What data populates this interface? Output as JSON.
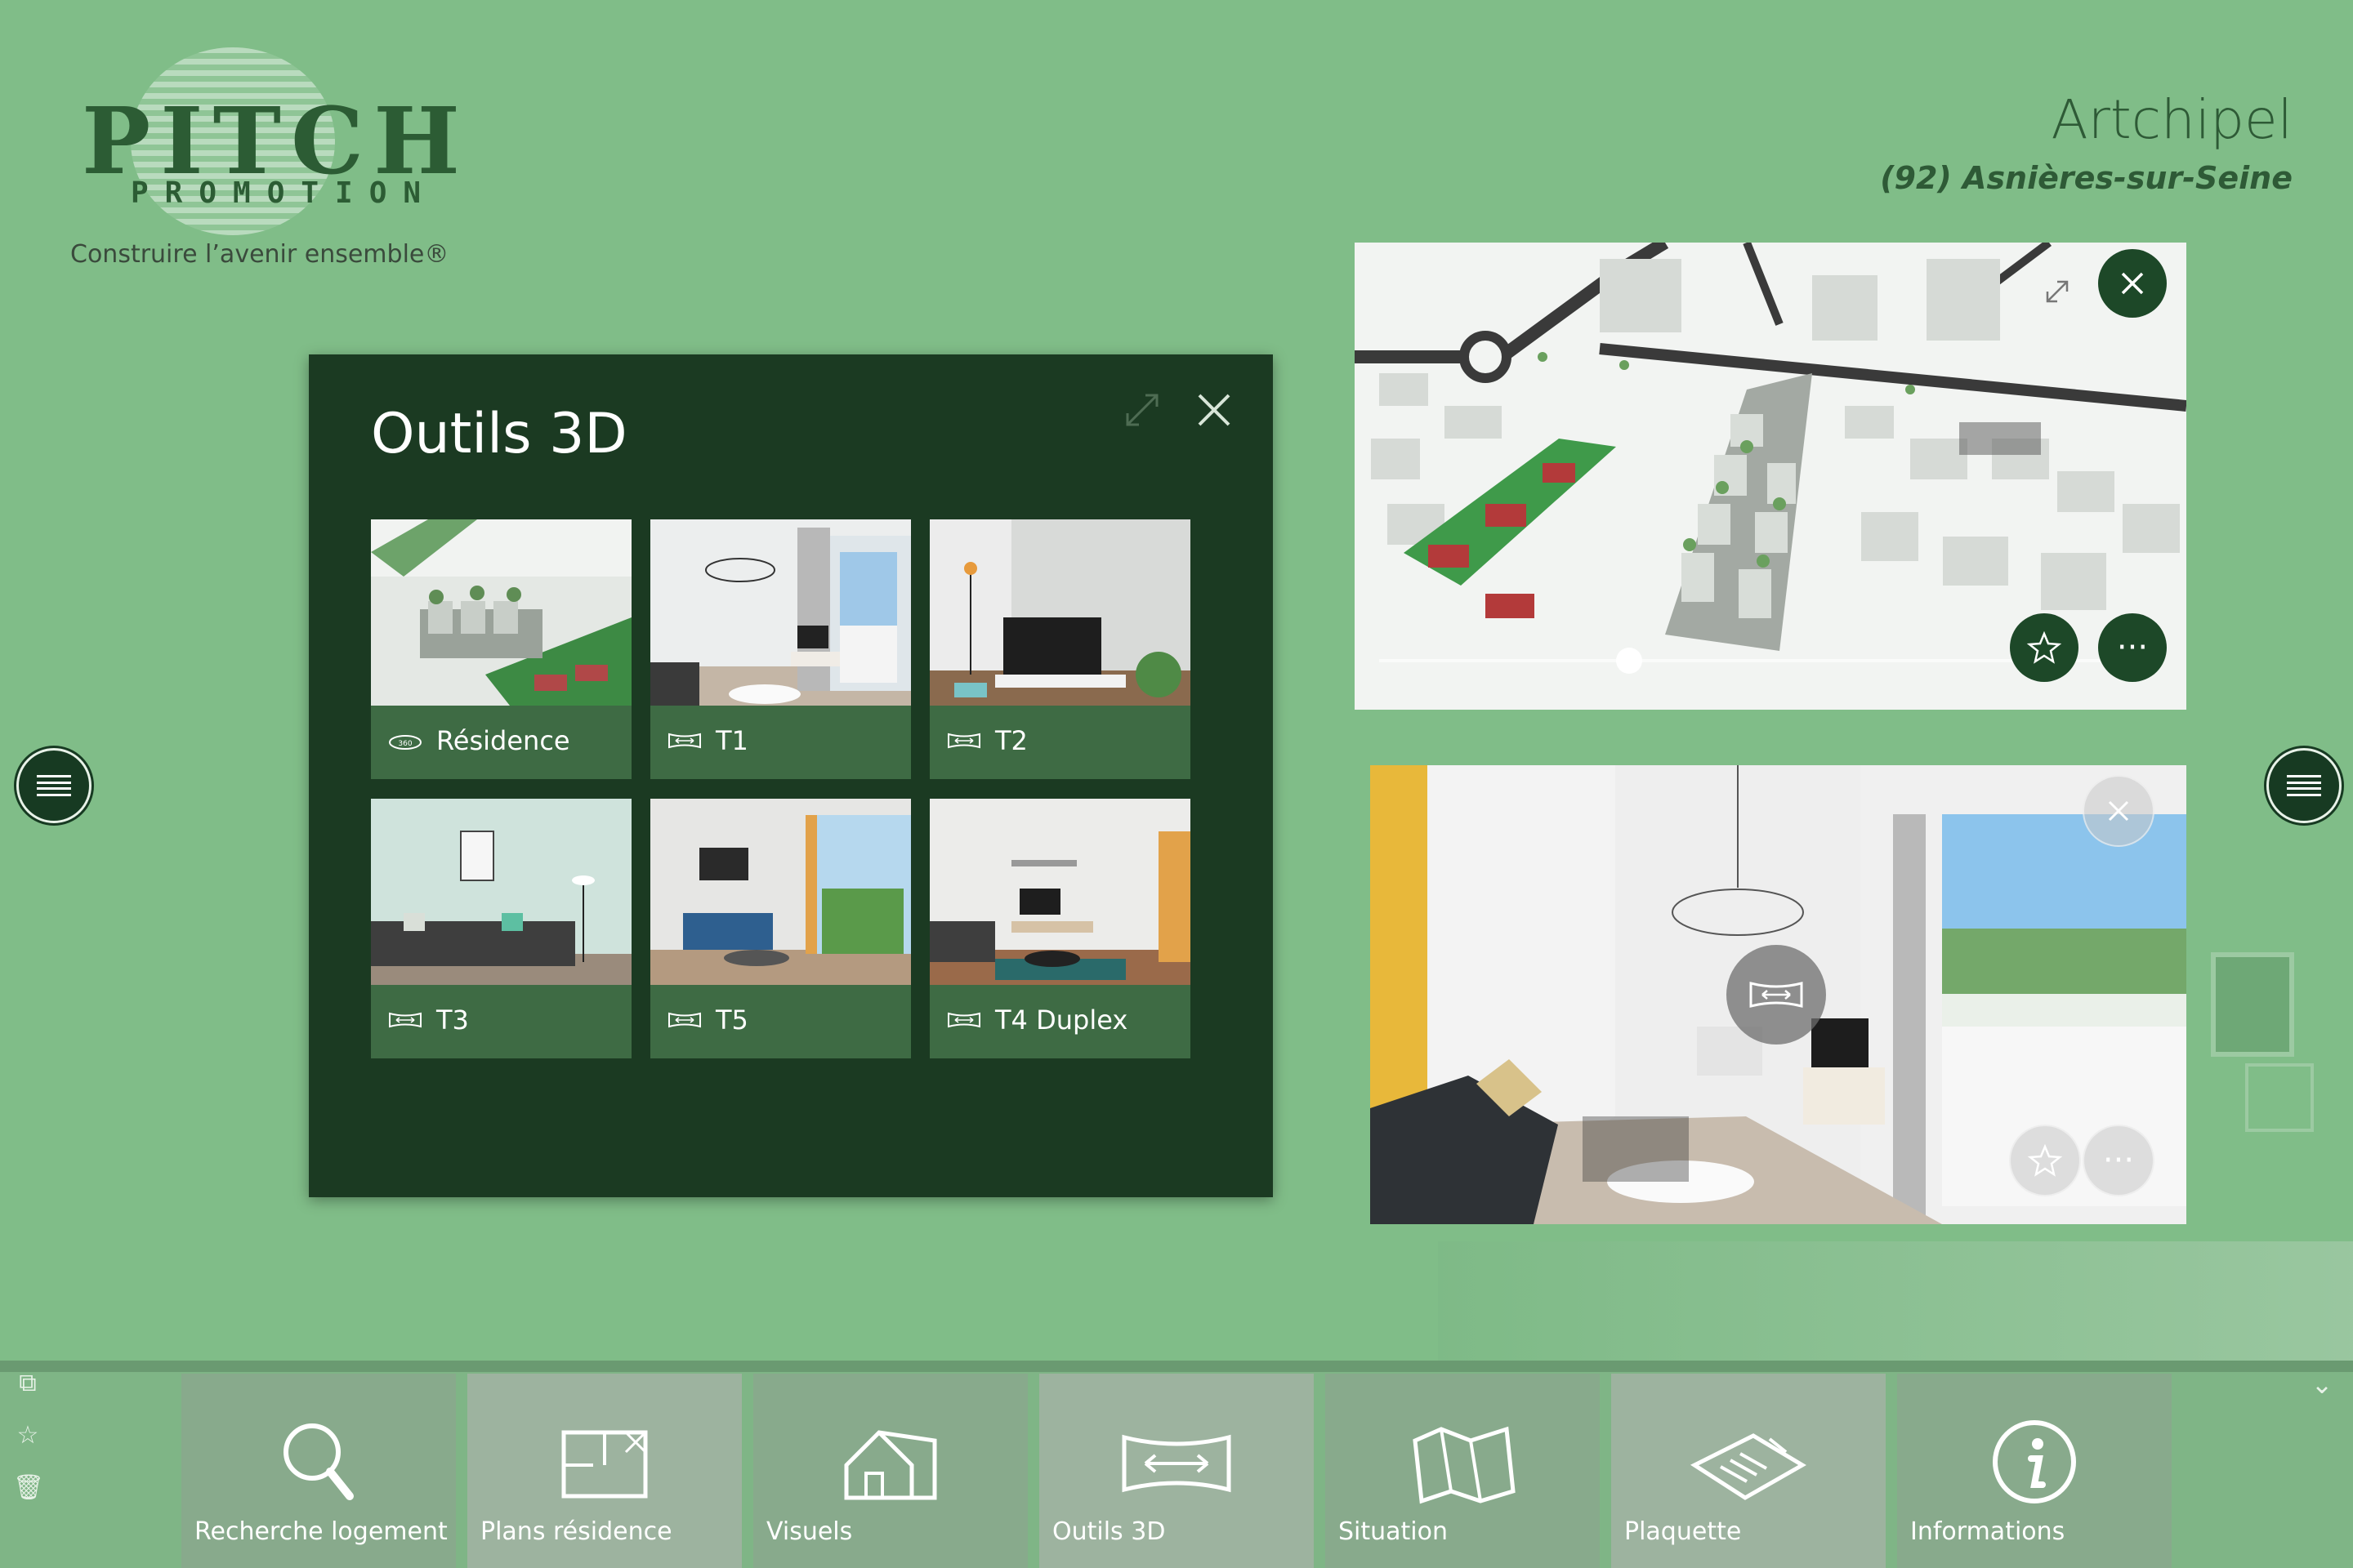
{
  "logo": {
    "word": "PITCH",
    "sub": "PROMOTION",
    "tagline": "Construire l’avenir ensemble®"
  },
  "project": {
    "title": "Artchipel",
    "location": "(92) Asnières-sur-Seine"
  },
  "panel": {
    "title": "Outils 3D",
    "tiles": [
      {
        "label": "Résidence",
        "icon": "360-icon"
      },
      {
        "label": "T1",
        "icon": "panorama-icon"
      },
      {
        "label": "T2",
        "icon": "panorama-icon"
      },
      {
        "label": "T3",
        "icon": "panorama-icon"
      },
      {
        "label": "T5",
        "icon": "panorama-icon"
      },
      {
        "label": "T4 Duplex",
        "icon": "panorama-icon"
      }
    ]
  },
  "viewers": {
    "top_more": "···",
    "bottom_more": "···"
  },
  "nav": [
    {
      "label": "Recherche logement",
      "icon": "search-icon"
    },
    {
      "label": "Plans résidence",
      "icon": "floorplan-icon"
    },
    {
      "label": "Visuels",
      "icon": "house-icon"
    },
    {
      "label": "Outils 3D",
      "icon": "panorama-icon"
    },
    {
      "label": "Situation",
      "icon": "map-icon"
    },
    {
      "label": "Plaquette",
      "icon": "brochure-icon"
    },
    {
      "label": "Informations",
      "icon": "info-icon"
    }
  ],
  "colors": {
    "background": "#80bd88",
    "panel": "#1b3a22",
    "tile": "#3e6b44",
    "accent_dark": "#1d4828"
  }
}
